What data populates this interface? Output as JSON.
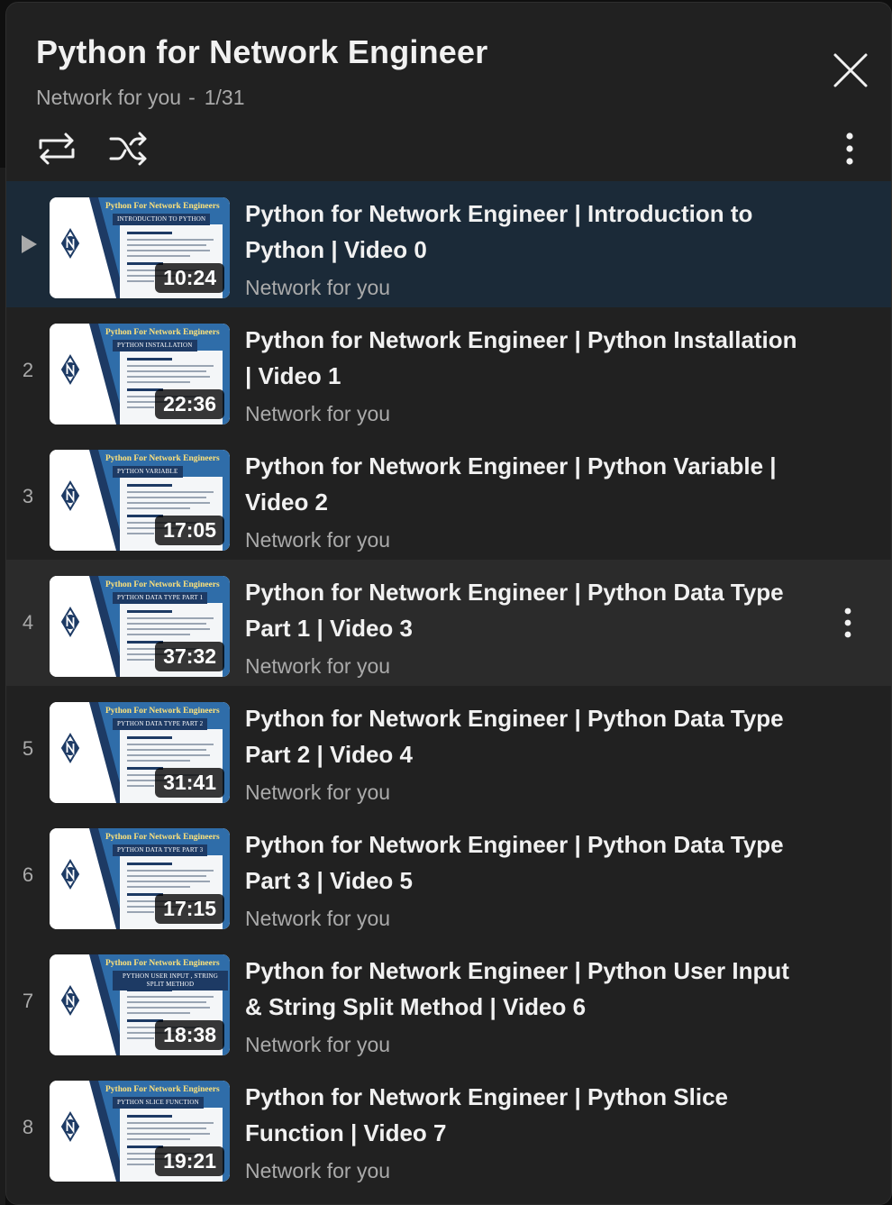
{
  "playlist": {
    "title": "Python for Network Engineer",
    "channel": "Network for you",
    "separator": "-",
    "position": "1/31"
  },
  "icons": {
    "close": "close-icon",
    "loop": "loop-icon",
    "shuffle": "shuffle-icon",
    "more": "more-vert-icon",
    "playing": "play-arrow-icon"
  },
  "colors": {
    "panel_bg": "#212121",
    "active_row_bg": "#1b2a38",
    "hover_row_bg": "#2b2b2b",
    "title_text": "#f1f1f1",
    "secondary_text": "#aaaaaa"
  },
  "thumb_brand": "Python For Network Engineers",
  "videos": [
    {
      "index": "▶",
      "playing": true,
      "title": "Python for Network Engineer | Introduction to Python | Video 0",
      "channel": "Network for you",
      "duration": "10:24",
      "topic": "INTRODUCTION TO PYTHON"
    },
    {
      "index": "2",
      "playing": false,
      "title": "Python for Network Engineer | Python Installation | Video 1",
      "channel": "Network for you",
      "duration": "22:36",
      "topic": "PYTHON INSTALLATION"
    },
    {
      "index": "3",
      "playing": false,
      "title": "Python for Network Engineer | Python Variable | Video 2",
      "channel": "Network for you",
      "duration": "17:05",
      "topic": "PYTHON VARIABLE"
    },
    {
      "index": "4",
      "playing": false,
      "hovered": true,
      "title": "Python for Network Engineer | Python Data Type Part 1 | Video 3",
      "channel": "Network for you",
      "duration": "37:32",
      "topic": "PYTHON DATA TYPE PART 1"
    },
    {
      "index": "5",
      "playing": false,
      "title": "Python for Network Engineer | Python Data Type Part 2 | Video 4",
      "channel": "Network for you",
      "duration": "31:41",
      "topic": "PYTHON DATA TYPE PART 2"
    },
    {
      "index": "6",
      "playing": false,
      "title": "Python for Network Engineer | Python Data Type Part 3 | Video 5",
      "channel": "Network for you",
      "duration": "17:15",
      "topic": "PYTHON DATA TYPE PART 3"
    },
    {
      "index": "7",
      "playing": false,
      "title": "Python for Network Engineer | Python User Input & String Split Method | Video 6",
      "channel": "Network for you",
      "duration": "18:38",
      "topic": "PYTHON USER INPUT , STRING SPLIT METHOD"
    },
    {
      "index": "8",
      "playing": false,
      "title": "Python for Network Engineer | Python Slice Function | Video 7",
      "channel": "Network for you",
      "duration": "19:21",
      "topic": "PYTHON SLICE FUNCTION"
    }
  ]
}
